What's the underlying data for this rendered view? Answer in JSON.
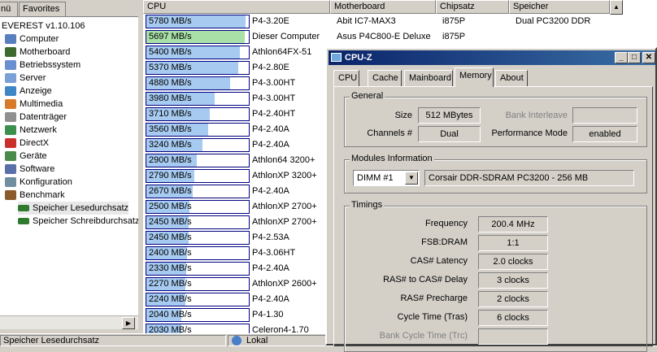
{
  "left_tabs": [
    "nü",
    "Favorites"
  ],
  "tree": {
    "root": "EVEREST v1.10.106",
    "items": [
      "Computer",
      "Motherboard",
      "Betriebssystem",
      "Server",
      "Anzeige",
      "Multimedia",
      "Datenträger",
      "Netzwerk",
      "DirectX",
      "Geräte",
      "Software",
      "Konfiguration",
      "Benchmark"
    ],
    "sub_items": [
      "Speicher Lesedurchsatz",
      "Speicher Schreibdurchsatz"
    ]
  },
  "table": {
    "headers": [
      "CPU",
      "Motherboard",
      "Chipsatz",
      "Speicher"
    ],
    "rows": [
      {
        "speed": "5780 MB/s",
        "pct": 0.97,
        "cpu": "P4-3.20E",
        "mb": "Abit IC7-MAX3",
        "chip": "i875P",
        "mem": "Dual PC3200 DDR"
      },
      {
        "speed": "5697 MB/s",
        "pct": 0.96,
        "cpu": "Dieser Computer",
        "mb": "Asus P4C800-E Deluxe",
        "chip": "i875P",
        "mem": "",
        "highlight": true
      },
      {
        "speed": "5400 MB/s",
        "pct": 0.91,
        "cpu": "Athlon64FX-51"
      },
      {
        "speed": "5370 MB/s",
        "pct": 0.9,
        "cpu": "P4-2.80E"
      },
      {
        "speed": "4880 MB/s",
        "pct": 0.82,
        "cpu": "P4-3.00HT"
      },
      {
        "speed": "3980 MB/s",
        "pct": 0.67,
        "cpu": "P4-3.00HT"
      },
      {
        "speed": "3710 MB/s",
        "pct": 0.62,
        "cpu": "P4-2.40HT"
      },
      {
        "speed": "3560 MB/s",
        "pct": 0.6,
        "cpu": "P4-2.40A"
      },
      {
        "speed": "3240 MB/s",
        "pct": 0.55,
        "cpu": "P4-2.40A"
      },
      {
        "speed": "2900 MB/s",
        "pct": 0.49,
        "cpu": "Athlon64 3200+"
      },
      {
        "speed": "2790 MB/s",
        "pct": 0.47,
        "cpu": "AthlonXP 3200+"
      },
      {
        "speed": "2670 MB/s",
        "pct": 0.45,
        "cpu": "P4-2.40A"
      },
      {
        "speed": "2500 MB/s",
        "pct": 0.42,
        "cpu": "AthlonXP 2700+"
      },
      {
        "speed": "2450 MB/s",
        "pct": 0.41,
        "cpu": "AthlonXP 2700+"
      },
      {
        "speed": "2450 MB/s",
        "pct": 0.41,
        "cpu": "P4-2.53A"
      },
      {
        "speed": "2400 MB/s",
        "pct": 0.4,
        "cpu": "P4-3.06HT"
      },
      {
        "speed": "2330 MB/s",
        "pct": 0.39,
        "cpu": "P4-2.40A"
      },
      {
        "speed": "2270 MB/s",
        "pct": 0.38,
        "cpu": "AthlonXP 2600+"
      },
      {
        "speed": "2240 MB/s",
        "pct": 0.38,
        "cpu": "P4-2.40A"
      },
      {
        "speed": "2040 MB/s",
        "pct": 0.34,
        "cpu": "P4-1.30"
      },
      {
        "speed": "2030 MB/s",
        "pct": 0.34,
        "cpu": "Celeron4-1.70"
      }
    ]
  },
  "status": {
    "left": "Speicher Lesedurchsatz",
    "right": "Lokal"
  },
  "cpuz": {
    "title": "CPU-Z",
    "tabs": [
      "CPU",
      "Cache",
      "Mainboard",
      "Memory",
      "About"
    ],
    "general": {
      "label": "General",
      "size_label": "Size",
      "size": "512 MBytes",
      "bank_label": "Bank Interleave",
      "bank": "",
      "channels_label": "Channels #",
      "channels": "Dual",
      "perf_label": "Performance Mode",
      "perf": "enabled"
    },
    "modules": {
      "label": "Modules Information",
      "slot": "DIMM #1",
      "desc": "Corsair DDR-SDRAM PC3200 - 256 MB"
    },
    "timings": {
      "label": "Timings",
      "rows": [
        {
          "label": "Frequency",
          "value": "200.4 MHz"
        },
        {
          "label": "FSB:DRAM",
          "value": "1:1"
        },
        {
          "label": "CAS# Latency",
          "value": "2.0 clocks"
        },
        {
          "label": "RAS# to CAS# Delay",
          "value": "3 clocks"
        },
        {
          "label": "RAS# Precharge",
          "value": "2 clocks"
        },
        {
          "label": "Cycle Time (Tras)",
          "value": "6 clocks"
        },
        {
          "label": "Bank Cycle Time (Trc)",
          "value": ""
        }
      ]
    }
  }
}
